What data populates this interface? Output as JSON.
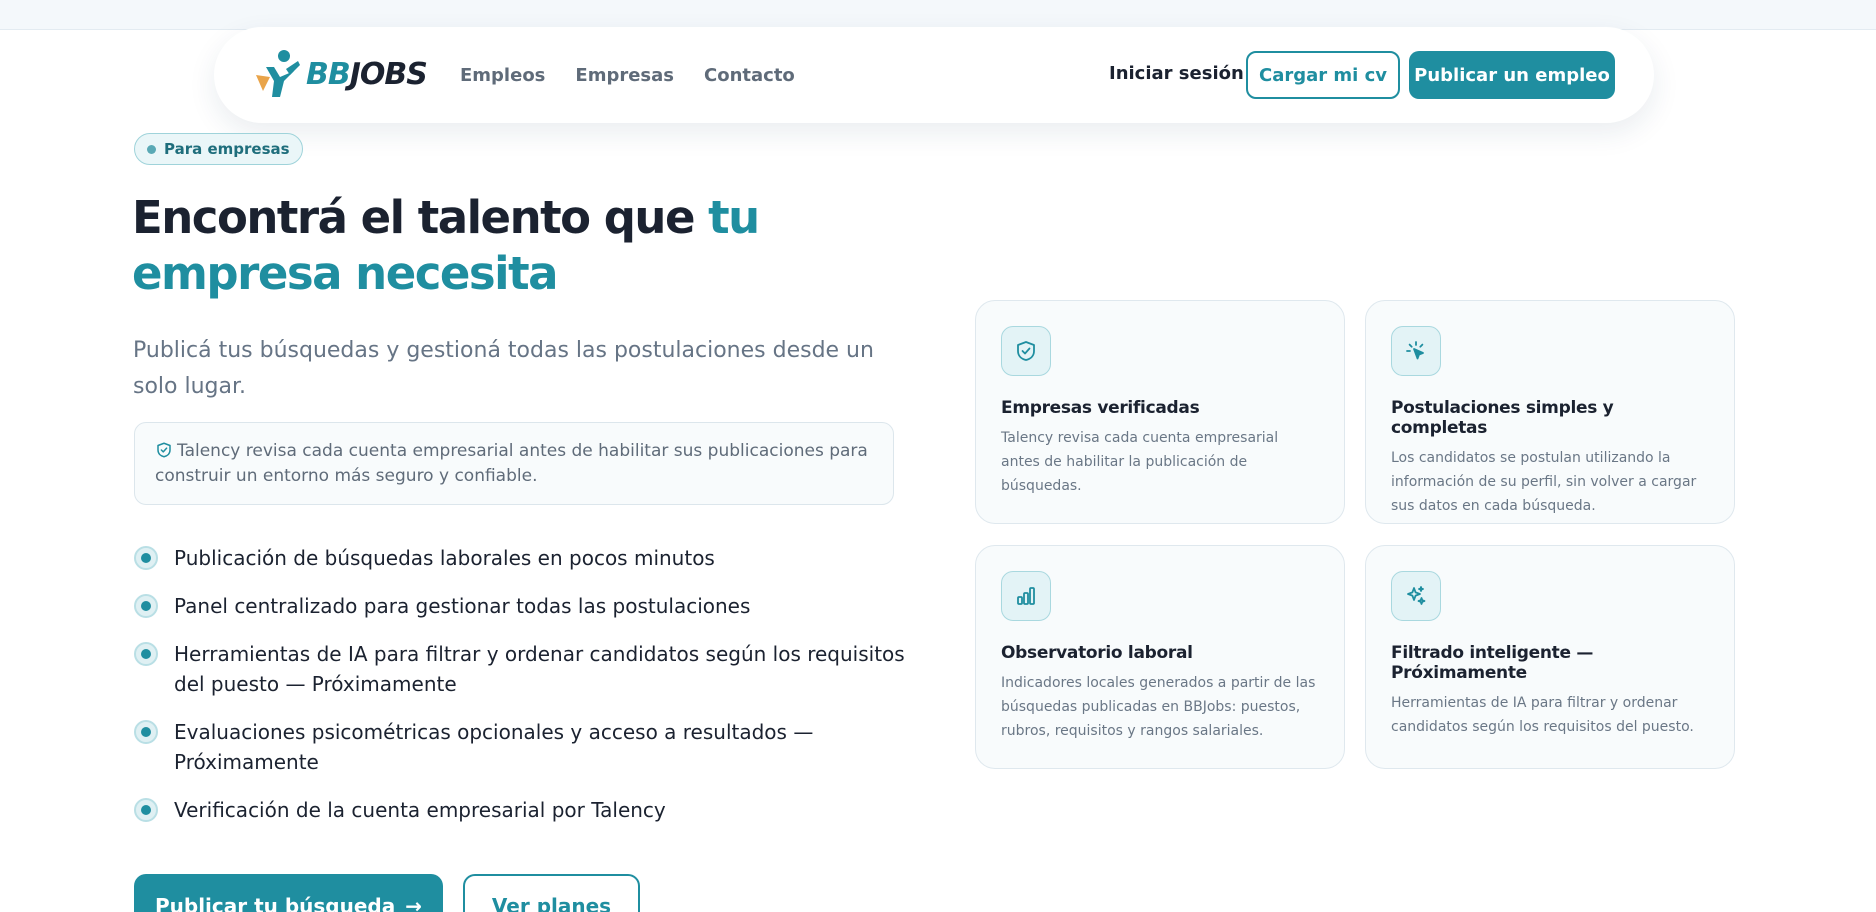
{
  "nav": {
    "logo_bb": "BB",
    "logo_jobs": "JOBS",
    "links": [
      "Empleos",
      "Empresas",
      "Contacto"
    ],
    "login": "Iniciar sesión",
    "upload_cv": "Cargar mi cv",
    "publish": "Publicar un empleo"
  },
  "hero": {
    "badge": "Para empresas",
    "title_main": "Encontrá el talento que ",
    "title_accent_1": "tu",
    "title_accent_2": "empresa necesita",
    "lead": "Publicá tus búsquedas y gestioná todas las postulaciones desde un solo lugar.",
    "notice": "Talency revisa cada cuenta empresarial antes de habilitar sus publicaciones para construir un entorno más seguro y confiable.",
    "features": [
      "Publicación de búsquedas laborales en pocos minutos",
      "Panel centralizado para gestionar todas las postulaciones",
      "Herramientas de IA para filtrar y ordenar candidatos según los requisitos del puesto — Próximamente",
      "Evaluaciones psicométricas opcionales y acceso a resultados — Próximamente",
      "Verificación de la cuenta empresarial por Talency"
    ],
    "cta_primary": "Publicar tu búsqueda",
    "cta_secondary": "Ver planes"
  },
  "cards": [
    {
      "icon": "shield-check-icon",
      "title": "Empresas verificadas",
      "text": "Talency revisa cada cuenta empresarial antes de habilitar la publicación de búsquedas."
    },
    {
      "icon": "pointer-click-icon",
      "title": "Postulaciones simples y completas",
      "text": "Los candidatos se postulan utilizando la información de su perfil, sin volver a cargar sus datos en cada búsqueda."
    },
    {
      "icon": "bar-chart-icon",
      "title": "Observatorio laboral",
      "text": "Indicadores locales generados a partir de las búsquedas publicadas en BBJobs: puestos, rubros, requisitos y rangos salariales."
    },
    {
      "icon": "sparkles-icon",
      "title": "Filtrado inteligente — Próximamente",
      "text": "Herramientas de IA para filtrar y ordenar candidatos según los requisitos del puesto."
    }
  ],
  "colors": {
    "accent": "#1f8ea0",
    "text": "#1b2230",
    "muted": "#667485"
  }
}
